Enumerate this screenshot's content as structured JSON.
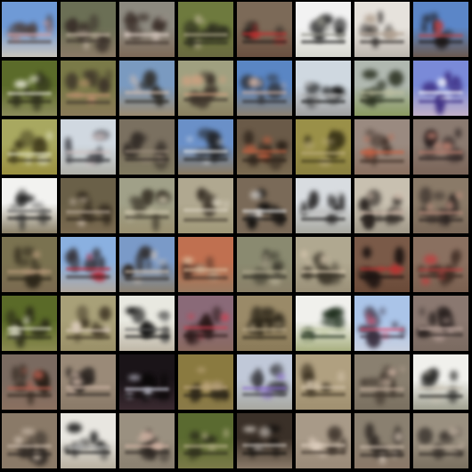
{
  "grid": {
    "rows": 8,
    "cols": 8,
    "tiles": [
      {
        "sky": "#6f9ad6",
        "ground": "#c9c4bd",
        "fig": "#4a3a34",
        "accent": "#d9a0a0"
      },
      {
        "sky": "#6b6f55",
        "ground": "#8a7a66",
        "fig": "#3a302a",
        "accent": "#c8b8a8"
      },
      {
        "sky": "#8d8a80",
        "ground": "#7d6a58",
        "fig": "#3a2e28",
        "accent": "#e0d0c8"
      },
      {
        "sky": "#6e7a3e",
        "ground": "#6a6a40",
        "fig": "#2f3020",
        "accent": "#b8b090"
      },
      {
        "sky": "#7c6a58",
        "ground": "#6a5040",
        "fig": "#1e1a18",
        "accent": "#c83030"
      },
      {
        "sky": "#f2f2f2",
        "ground": "#d8d8d0",
        "fig": "#151515",
        "accent": "#8a8a80"
      },
      {
        "sky": "#e6e2dc",
        "ground": "#bcb6ae",
        "fig": "#2a2624",
        "accent": "#b0a090"
      },
      {
        "sky": "#5b86c8",
        "ground": "#6b5a50",
        "fig": "#1a1412",
        "accent": "#c04040"
      },
      {
        "sky": "#5b6b2a",
        "ground": "#8a8a5a",
        "fig": "#2a2a1a",
        "accent": "#e8e8d8"
      },
      {
        "sky": "#7a7a48",
        "ground": "#8a7a58",
        "fig": "#3a3028",
        "accent": "#c09070"
      },
      {
        "sky": "#7a9ac0",
        "ground": "#9a8a70",
        "fig": "#2a2620",
        "accent": "#d8c0b0"
      },
      {
        "sky": "#a0a080",
        "ground": "#8a8060",
        "fig": "#3a3028",
        "accent": "#d0a080"
      },
      {
        "sky": "#5a86c4",
        "ground": "#8a8070",
        "fig": "#2a2828",
        "accent": "#d0b0a0"
      },
      {
        "sky": "#cfd8e0",
        "ground": "#a0a0a0",
        "fig": "#141414",
        "accent": "#b0b0b0"
      },
      {
        "sky": "#b0b8b0",
        "ground": "#8a9a60",
        "fig": "#2a3020",
        "accent": "#c0c0a0"
      },
      {
        "sky": "#7a8ad8",
        "ground": "#c0b0c8",
        "fig": "#3a2a80",
        "accent": "#ffffff"
      },
      {
        "sky": "#a8a860",
        "ground": "#9a9040",
        "fig": "#3a3418",
        "accent": "#e0e0c0"
      },
      {
        "sky": "#d0d8e0",
        "ground": "#b0b0a8",
        "fig": "#2a2a30",
        "accent": "#d0c0c0"
      },
      {
        "sky": "#7a7060",
        "ground": "#807a60",
        "fig": "#2a2420",
        "accent": "#a09080"
      },
      {
        "sky": "#6a90c8",
        "ground": "#8a7a60",
        "fig": "#1a1816",
        "accent": "#f0f0f0"
      },
      {
        "sky": "#6a5a48",
        "ground": "#7a6a50",
        "fig": "#2a2018",
        "accent": "#c06040"
      },
      {
        "sky": "#9a9048",
        "ground": "#8a8040",
        "fig": "#3a3418",
        "accent": "#c0b080"
      },
      {
        "sky": "#9a8a80",
        "ground": "#8a7060",
        "fig": "#3a2a22",
        "accent": "#d06040"
      },
      {
        "sky": "#8a7a70",
        "ground": "#7a6458",
        "fig": "#2a2020",
        "accent": "#c08070"
      },
      {
        "sky": "#f2f2f0",
        "ground": "#8a8068",
        "fig": "#101010",
        "accent": "#606060"
      },
      {
        "sky": "#6a6048",
        "ground": "#7a6a50",
        "fig": "#2a2218",
        "accent": "#c0b0a0"
      },
      {
        "sky": "#a0a088",
        "ground": "#9a9070",
        "fig": "#3a3428",
        "accent": "#d0c8b0"
      },
      {
        "sky": "#b0a890",
        "ground": "#a09878",
        "fig": "#3a3228",
        "accent": "#e0d8c8"
      },
      {
        "sky": "#7a6a58",
        "ground": "#7a6a58",
        "fig": "#141210",
        "accent": "#f0f0f0"
      },
      {
        "sky": "#d8dce0",
        "ground": "#a8a8a0",
        "fig": "#1a1818",
        "accent": "#c0c0c0"
      },
      {
        "sky": "#c8c0b0",
        "ground": "#a09888",
        "fig": "#2a2420",
        "accent": "#d8c0b0"
      },
      {
        "sky": "#8a7a68",
        "ground": "#7a6858",
        "fig": "#2a2220",
        "accent": "#c09080"
      },
      {
        "sky": "#7a7250",
        "ground": "#7a6a50",
        "fig": "#2a2418",
        "accent": "#c0a080"
      },
      {
        "sky": "#8ab0e0",
        "ground": "#b0a8a0",
        "fig": "#2a2020",
        "accent": "#c02030"
      },
      {
        "sky": "#7a9ac8",
        "ground": "#8a8070",
        "fig": "#2a2420",
        "accent": "#d8c8b8"
      },
      {
        "sky": "#c07050",
        "ground": "#9a7a60",
        "fig": "#3a2820",
        "accent": "#e0c0a0"
      },
      {
        "sky": "#8a8a70",
        "ground": "#8a8068",
        "fig": "#2a2820",
        "accent": "#b0a890"
      },
      {
        "sky": "#b0a890",
        "ground": "#9a9078",
        "fig": "#3a3428",
        "accent": "#d8c8b0"
      },
      {
        "sky": "#7a5a48",
        "ground": "#6a4a38",
        "fig": "#1a1210",
        "accent": "#c03030"
      },
      {
        "sky": "#8a7060",
        "ground": "#7a6050",
        "fig": "#3a2820",
        "accent": "#c04040"
      },
      {
        "sky": "#5a6a28",
        "ground": "#8a8a50",
        "fig": "#2a2a18",
        "accent": "#e0e0c8"
      },
      {
        "sky": "#a8a078",
        "ground": "#9a9068",
        "fig": "#3a3020",
        "accent": "#e0d0c0"
      },
      {
        "sky": "#e8e8e0",
        "ground": "#c0b8a8",
        "fig": "#0e0e0e",
        "accent": "#606060"
      },
      {
        "sky": "#8a6a78",
        "ground": "#8a6a60",
        "fig": "#2a1818",
        "accent": "#d04050"
      },
      {
        "sky": "#9a8a68",
        "ground": "#8a7a58",
        "fig": "#2a2418",
        "accent": "#c0b090"
      },
      {
        "sky": "#f0f0ec",
        "ground": "#a8b080",
        "fig": "#1a2a18",
        "accent": "#c0c8a0"
      },
      {
        "sky": "#aac4e8",
        "ground": "#c8d0e0",
        "fig": "#3a3040",
        "accent": "#e05070"
      },
      {
        "sky": "#8a7870",
        "ground": "#7a6a60",
        "fig": "#2a2220",
        "accent": "#c0a8a0"
      },
      {
        "sky": "#7a6a60",
        "ground": "#8a7060",
        "fig": "#2a2018",
        "accent": "#c06050"
      },
      {
        "sky": "#9a8a78",
        "ground": "#8a7a68",
        "fig": "#2a2420",
        "accent": "#d0b8a8"
      },
      {
        "sky": "#1a1418",
        "ground": "#3a2a30",
        "fig": "#0a0808",
        "accent": "#e0e0f0"
      },
      {
        "sky": "#8a7a40",
        "ground": "#8a7a48",
        "fig": "#2a2418",
        "accent": "#c0a880"
      },
      {
        "sky": "#c0c8d8",
        "ground": "#a8a8a0",
        "fig": "#3a3a40",
        "accent": "#8a6ad0"
      },
      {
        "sky": "#b0a080",
        "ground": "#a09070",
        "fig": "#3a3020",
        "accent": "#d8c8b0"
      },
      {
        "sky": "#8a8070",
        "ground": "#7a7060",
        "fig": "#3a3028",
        "accent": "#c8b0a0"
      },
      {
        "sky": "#f0f0ec",
        "ground": "#a0a090",
        "fig": "#1a1a18",
        "accent": "#c8c0b0"
      },
      {
        "sky": "#8a7a68",
        "ground": "#8a7a68",
        "fig": "#2a2420",
        "accent": "#d0c0b0"
      },
      {
        "sky": "#e8e6e0",
        "ground": "#b8b0a0",
        "fig": "#1a1a1a",
        "accent": "#a0a0a0"
      },
      {
        "sky": "#9a9080",
        "ground": "#8a8070",
        "fig": "#2a2420",
        "accent": "#d8b8a8"
      },
      {
        "sky": "#5a6a30",
        "ground": "#7a7a48",
        "fig": "#2a2a1a",
        "accent": "#c0b890"
      },
      {
        "sky": "#3a3028",
        "ground": "#8a7a68",
        "fig": "#0e0c0a",
        "accent": "#d0c8c0"
      },
      {
        "sky": "#a89a88",
        "ground": "#9a8a78",
        "fig": "#3a3028",
        "accent": "#e0d0c0"
      },
      {
        "sky": "#8a8070",
        "ground": "#8a7868",
        "fig": "#2a2420",
        "accent": "#d0c0b0"
      },
      {
        "sky": "#9a9080",
        "ground": "#7a7060",
        "fig": "#2a2420",
        "accent": "#c0b0a0"
      }
    ]
  }
}
